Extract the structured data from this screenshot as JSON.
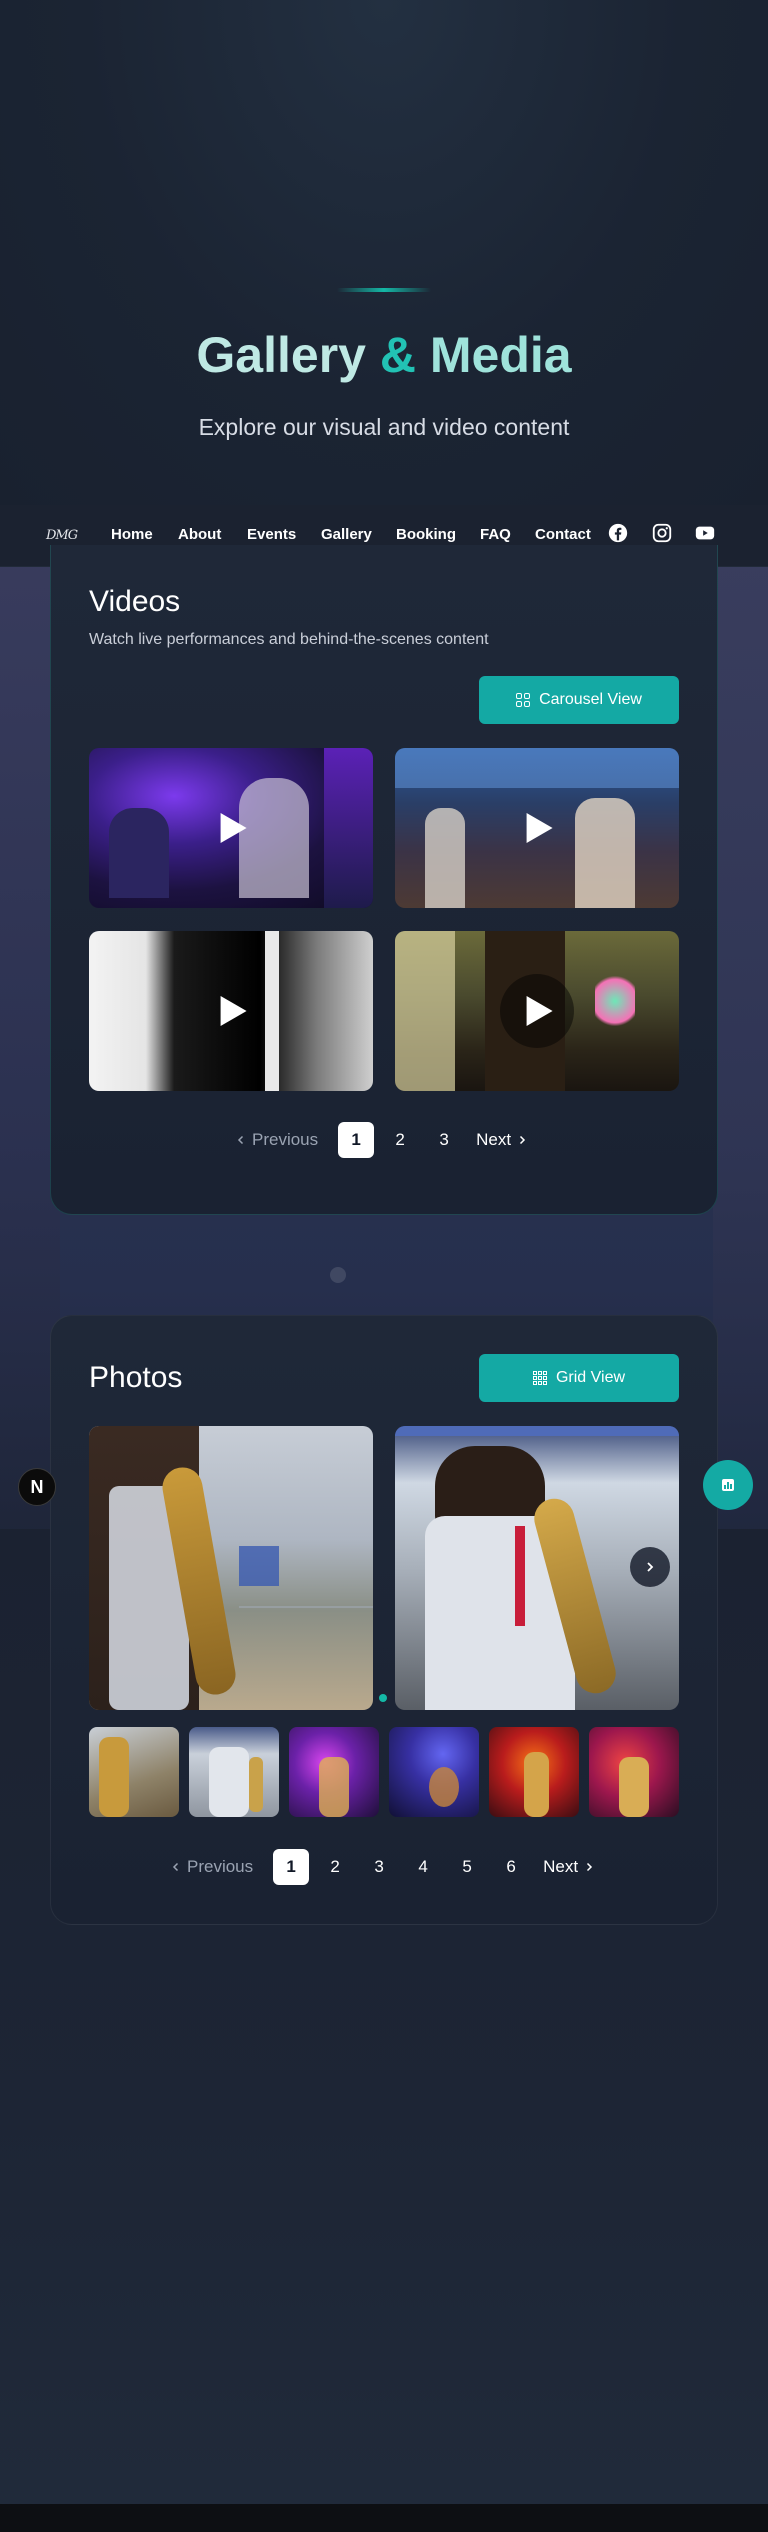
{
  "hero": {
    "title_part1": "Gallery",
    "title_amp": "&",
    "title_part2": "Media",
    "subtitle": "Explore our visual and video content"
  },
  "nav": {
    "logo_text": "DMG",
    "items": [
      "Home",
      "About",
      "Events",
      "Gallery",
      "Booking",
      "FAQ",
      "Contact"
    ],
    "social": [
      "facebook-icon",
      "instagram-icon",
      "youtube-icon"
    ]
  },
  "videos": {
    "title": "Videos",
    "subtitle": "Watch live performances and behind-the-scenes content",
    "view_button": "Carousel View",
    "items": [
      {
        "scene": "dance-floor-purple"
      },
      {
        "scene": "party-room-blue"
      },
      {
        "scene": "saxophone-monochrome"
      },
      {
        "scene": "stage-warm-light"
      }
    ],
    "pager": {
      "prev": "Previous",
      "pages": [
        "1",
        "2",
        "3"
      ],
      "current": "1",
      "next": "Next"
    }
  },
  "photos": {
    "title": "Photos",
    "view_button": "Grid View",
    "pager": {
      "prev": "Previous",
      "pages": [
        "1",
        "2",
        "3",
        "4",
        "5",
        "6"
      ],
      "current": "1",
      "next": "Next"
    }
  },
  "floating": {
    "left_badge": "N"
  },
  "colors": {
    "accent": "#14a9a4",
    "background": "#1a2130",
    "card": "#1f2838"
  }
}
